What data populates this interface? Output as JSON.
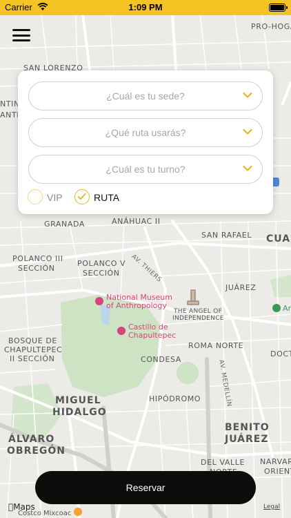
{
  "status_bar": {
    "carrier": "Carrier",
    "time": "1:09 PM"
  },
  "form": {
    "sede_placeholder": "¿Cuál es tu sede?",
    "ruta_placeholder": "¿Qué ruta usarás?",
    "turno_placeholder": "¿Cuál es tu turno?",
    "options": [
      {
        "label": "VIP",
        "selected": false
      },
      {
        "label": "RUTA",
        "selected": true
      }
    ]
  },
  "reserve_label": "Reservar",
  "map": {
    "labels": {
      "pro_hogar": "PRO-HOGAR",
      "san_lorenzo": "SAN LORENZO",
      "ntina": "NTINA",
      "ante": "ANTE",
      "granada": "GRANADA",
      "anahuac": "ANÁHUAC II",
      "san_rafael": "SAN RAFAEL",
      "cuau": "CUAU",
      "polanco3_a": "POLANCO III",
      "polanco3_b": "SECCIÓN",
      "polanco5_a": "POLANCO V",
      "polanco5_b": "SECCIÓN",
      "av_thiers": "AV. THIERS",
      "juarez": "JUÁREZ",
      "museum_a": "National Museum",
      "museum_b": "of Anthropology",
      "angel_a": "THE ANGEL OF",
      "angel_b": "INDEPENDENCE",
      "castillo_a": "Castillo de",
      "castillo_b": "Chapultepec",
      "bosque_a": "BOSQUE DE",
      "bosque_b": "CHAPULTEPEC",
      "bosque_c": "II SECCIÓN",
      "roma_norte": "ROMA NORTE",
      "condesa": "CONDESA",
      "av_medellin": "AV. MEDELLÍN",
      "doct": "DOCT",
      "miguel": "MIGUEL",
      "hidalgo": "HIDALGO",
      "hipodromo": "HIPÓDROMO",
      "alvaro": "ÁLVARO",
      "obregon": "OBREGÓN",
      "benito": "BENITO",
      "juarez2": "JUÁREZ",
      "del_valle_a": "DEL VALLE",
      "del_valle_b": "NORTE",
      "narvar_a": "NARVAR",
      "narvar_b": "ORIENT",
      "ar": "Ar",
      "legal": "Legal",
      "maps": "Maps",
      "costco": "Costco Mixcoac"
    }
  },
  "colors": {
    "accent": "#f4c425",
    "button": "#0d0d0b",
    "poi": "#d6457a",
    "park": "#cde3c4"
  }
}
